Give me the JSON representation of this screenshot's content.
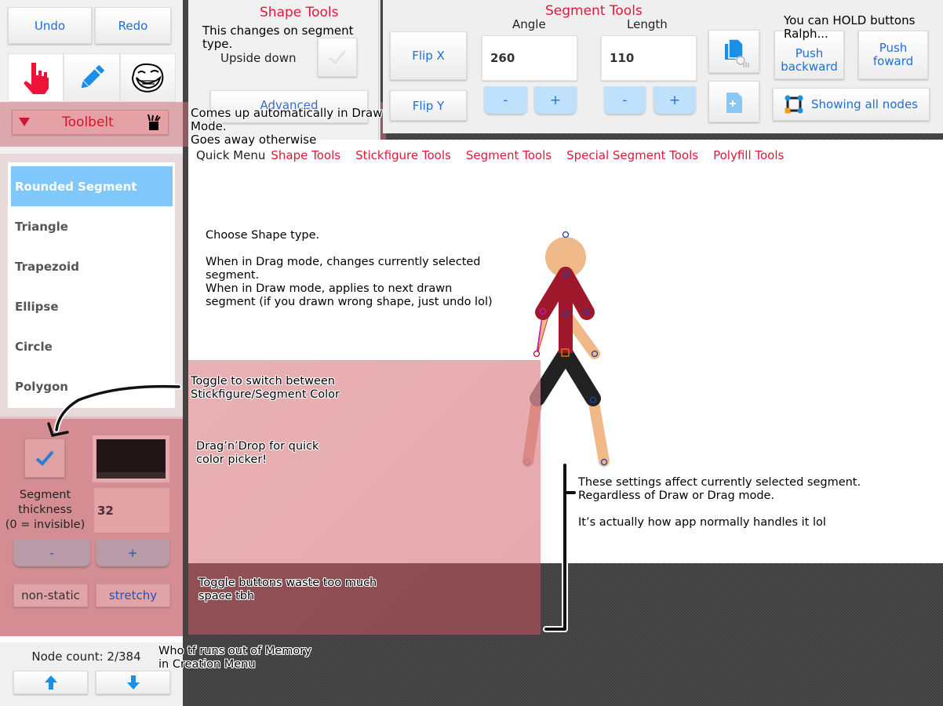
{
  "left_panel": {
    "undo_label": "Undo",
    "redo_label": "Redo",
    "modes": [
      {
        "name": "drag-mode",
        "icon": "hand-pointer-icon",
        "active": true
      },
      {
        "name": "draw-mode",
        "icon": "pencil-icon",
        "active": false
      },
      {
        "name": "troll-mode",
        "icon": "trollface-icon",
        "active": false
      }
    ],
    "toolbelt_label": "Toolbelt",
    "shape_types": [
      {
        "label": "Rounded Segment",
        "selected": true
      },
      {
        "label": "Triangle",
        "selected": false
      },
      {
        "label": "Trapezoid",
        "selected": false
      },
      {
        "label": "Ellipse",
        "selected": false
      },
      {
        "label": "Circle",
        "selected": false
      },
      {
        "label": "Polygon",
        "selected": false
      }
    ],
    "color_toggle_checked": true,
    "color_swatch": "#221518",
    "thickness_label": "Segment thickness (0 = invisible)",
    "thickness_label_lines": [
      "Segment",
      "thickness",
      "(0 = invisible)"
    ],
    "thickness_value": "32",
    "minus_label": "-",
    "plus_label": "+",
    "static_toggle_label": "non-static",
    "stretchy_toggle_label": "stretchy",
    "node_count": "Node count: 2/384",
    "up_icon": "arrow-up-icon",
    "down_icon": "arrow-down-icon"
  },
  "shape_tools": {
    "title": "Shape Tools",
    "upside_down_label": "Upside down",
    "upside_down_checked": false,
    "advanced_label": "Advanced"
  },
  "segment_tools": {
    "title": "Segment Tools",
    "flip_x_label": "Flip X",
    "flip_y_label": "Flip Y",
    "angle_label": "Angle",
    "angle_value": "260",
    "length_label": "Length",
    "length_value": "110",
    "minus_label": "-",
    "plus_label": "+",
    "copy_icon": "copy-icon",
    "paste_icon": "paste-icon",
    "push_backward_label": "Push backward",
    "push_forward_label": "Push foward",
    "show_nodes_label": "Showing all nodes"
  },
  "quick_menu": {
    "label": "Quick Menu",
    "items": [
      "Shape Tools",
      "Stickfigure Tools",
      "Segment Tools",
      "Special Segment Tools",
      "Polyfill Tools"
    ]
  },
  "annotations": {
    "segment_type": [
      "This changes on segment",
      "type."
    ],
    "toolbelt": [
      "Comes up automatically in Draw",
      "Mode.",
      "Goes away otherwise"
    ],
    "hold_buttons": [
      "You can HOLD buttons",
      "Ralph..."
    ],
    "choose_shape": [
      "Choose Shape type.",
      "",
      "When in Drag mode, changes currently selected",
      "segment.",
      "When in Draw mode, applies to next drawn",
      "segment (if you drawn wrong shape, just undo lol)"
    ],
    "color_toggle": [
      "Toggle to switch between",
      "Stickfigure/Segment Color"
    ],
    "drag_drop": [
      "Drag’n’Drop for quick",
      "color picker!"
    ],
    "settings_affect": [
      "These settings affect currently selected segment.",
      "Regardless of Draw or Drag mode.",
      "",
      "It’s actually how app normally handles it lol"
    ],
    "toggle_waste": [
      "Toggle buttons waste too much",
      "space tbh"
    ],
    "memory": [
      "Who tf runs out of Memory",
      "in Creation Menu"
    ]
  },
  "colors": {
    "accent_red": "#e0173a",
    "accent_blue": "#1e6fd6",
    "selected_item": "#80c8fc",
    "figure_head": "#f0b98a",
    "figure_torso": "#a0182b",
    "figure_legs": "#222222",
    "figure_selected_limb": "#d8744f"
  }
}
